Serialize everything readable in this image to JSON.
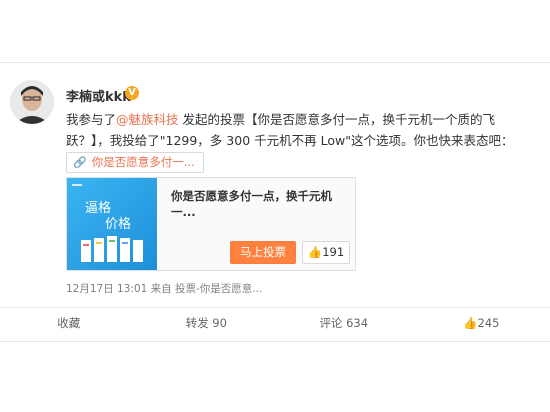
{
  "user": {
    "name": "李楠或kkk",
    "verified_badge": "V"
  },
  "post": {
    "prefix": "我参与了",
    "at_link": "@魅族科技",
    "text": " 发起的投票【你是否愿意多付一点，换千元机一个质的飞跃？】，我投给了\"1299，多 300 千元机不再 Low\"这个选项。你也快来表态吧："
  },
  "vote_chip": {
    "icon": "link-icon",
    "label": "你是否愿意多付一..."
  },
  "vote_card": {
    "thumb_text_1": "逼格",
    "thumb_text_2": "价格",
    "title": "你是否愿意多付一点，换千元机一...",
    "vote_button": "马上投票",
    "like_count": "191"
  },
  "meta": "12月17日 13:01 来自 投票-你是否愿意...",
  "actions": {
    "favorite": "收藏",
    "repost": "转发 90",
    "comment": "评论 634",
    "like": "245"
  },
  "colors": {
    "accent": "#eb7350",
    "vote_button": "#ff8140",
    "badge": "#f5a623"
  }
}
